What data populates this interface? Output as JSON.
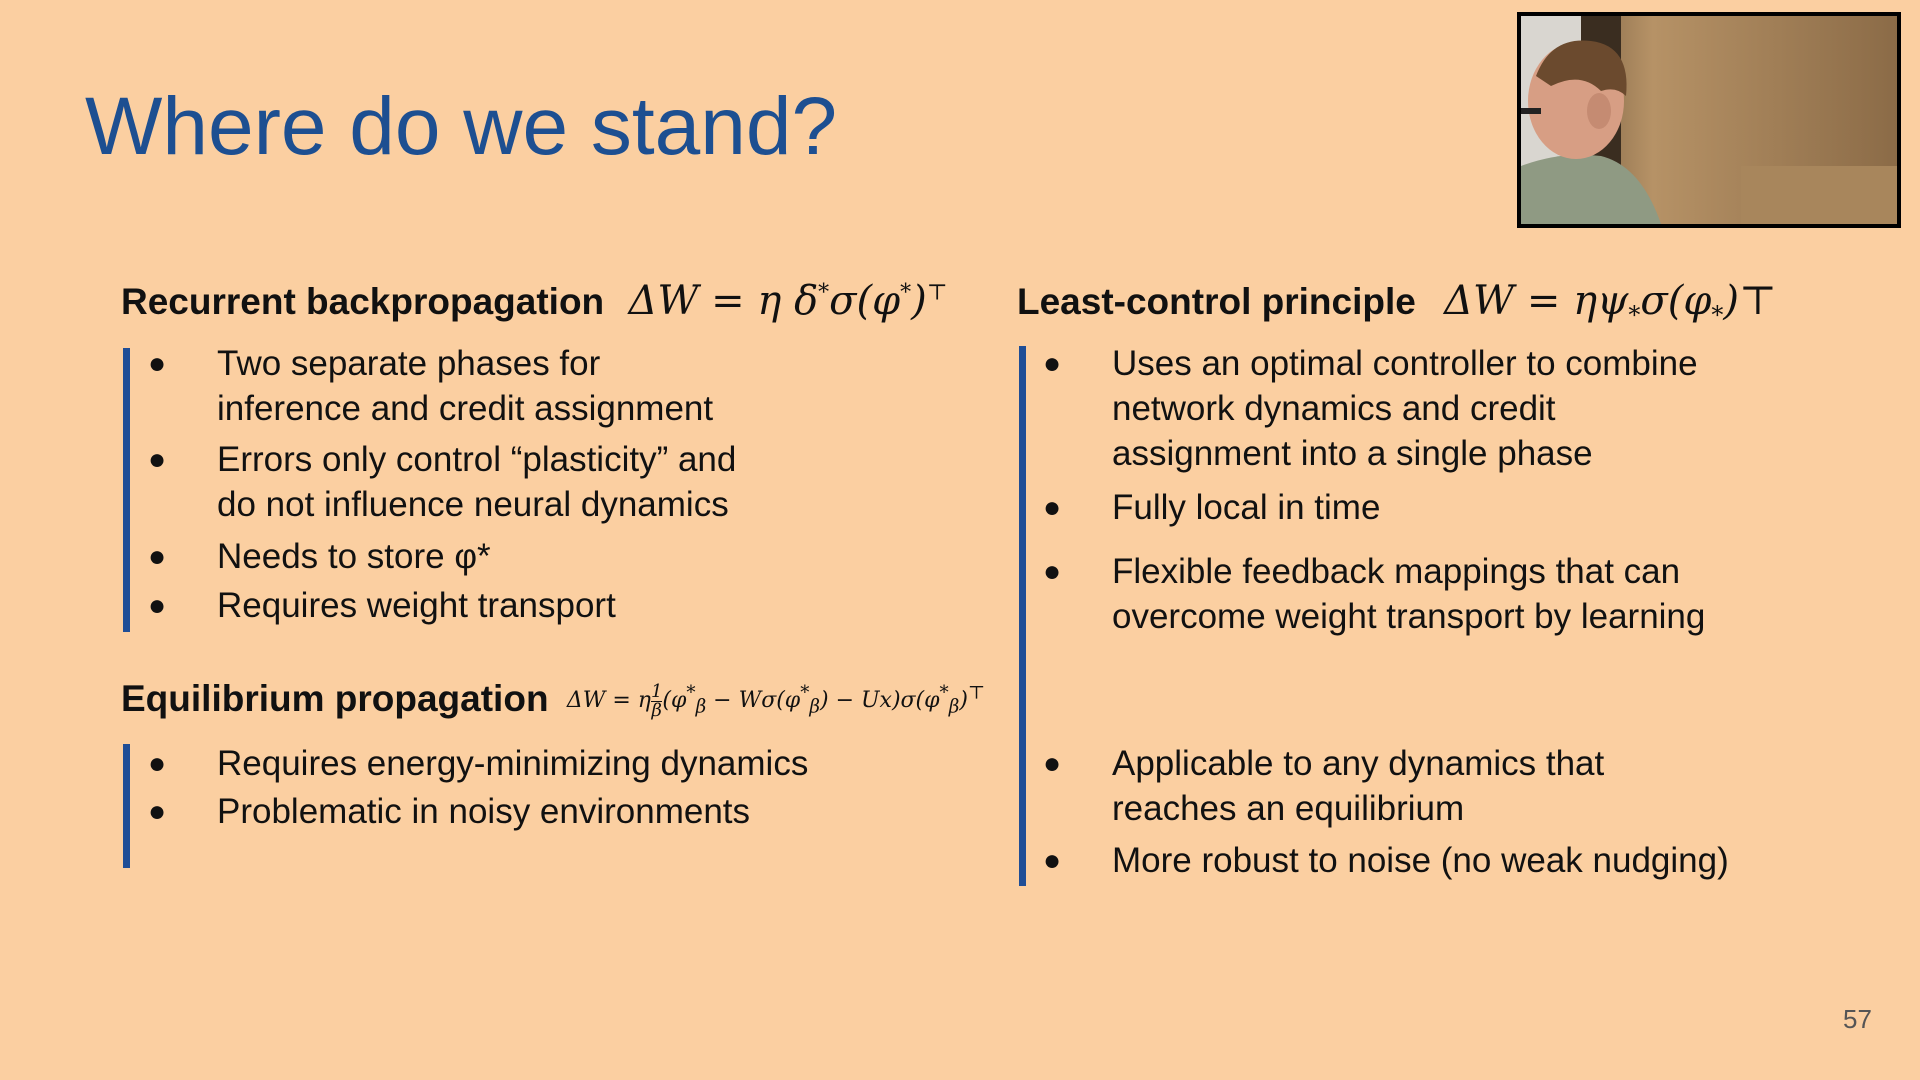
{
  "slide": {
    "title": "Where do we stand?",
    "page_number": "57"
  },
  "left": {
    "sections": [
      {
        "heading": "Recurrent backpropagation",
        "formula": "ΔW = η δ*σ(φ*)ᵀ",
        "bullets": [
          "Two separate phases for\ninference and credit assignment",
          "Errors only control “plasticity” and\ndo not influence neural dynamics",
          "Needs to store φ*",
          "Requires weight transport"
        ]
      },
      {
        "heading": "Equilibrium propagation",
        "formula": "ΔW = η(1/β)(φ*β − Wσ(φ*β) − Ux)σ(φ*β)ᵀ",
        "bullets": [
          "Requires energy-minimizing dynamics",
          "Problematic in noisy environments"
        ]
      }
    ]
  },
  "right": {
    "heading": "Least-control principle",
    "formula": "ΔW = ηψ*σ(φ*)⊤",
    "bullets": [
      "Uses an optimal controller to combine\nnetwork dynamics and credit\nassignment into a single phase",
      "Fully local in time",
      "Flexible feedback mappings that can\novercome weight transport by learning",
      "Applicable to any dynamics that\nreaches an equilibrium",
      "More robust to noise (no weak nudging)"
    ]
  },
  "icons": {
    "bullet": "black-dot",
    "webcam": "speaker-webcam-thumbnail"
  },
  "colors": {
    "background": "#fbcfa1",
    "title": "#1d4f91",
    "accent_bar": "#1f4e96"
  }
}
